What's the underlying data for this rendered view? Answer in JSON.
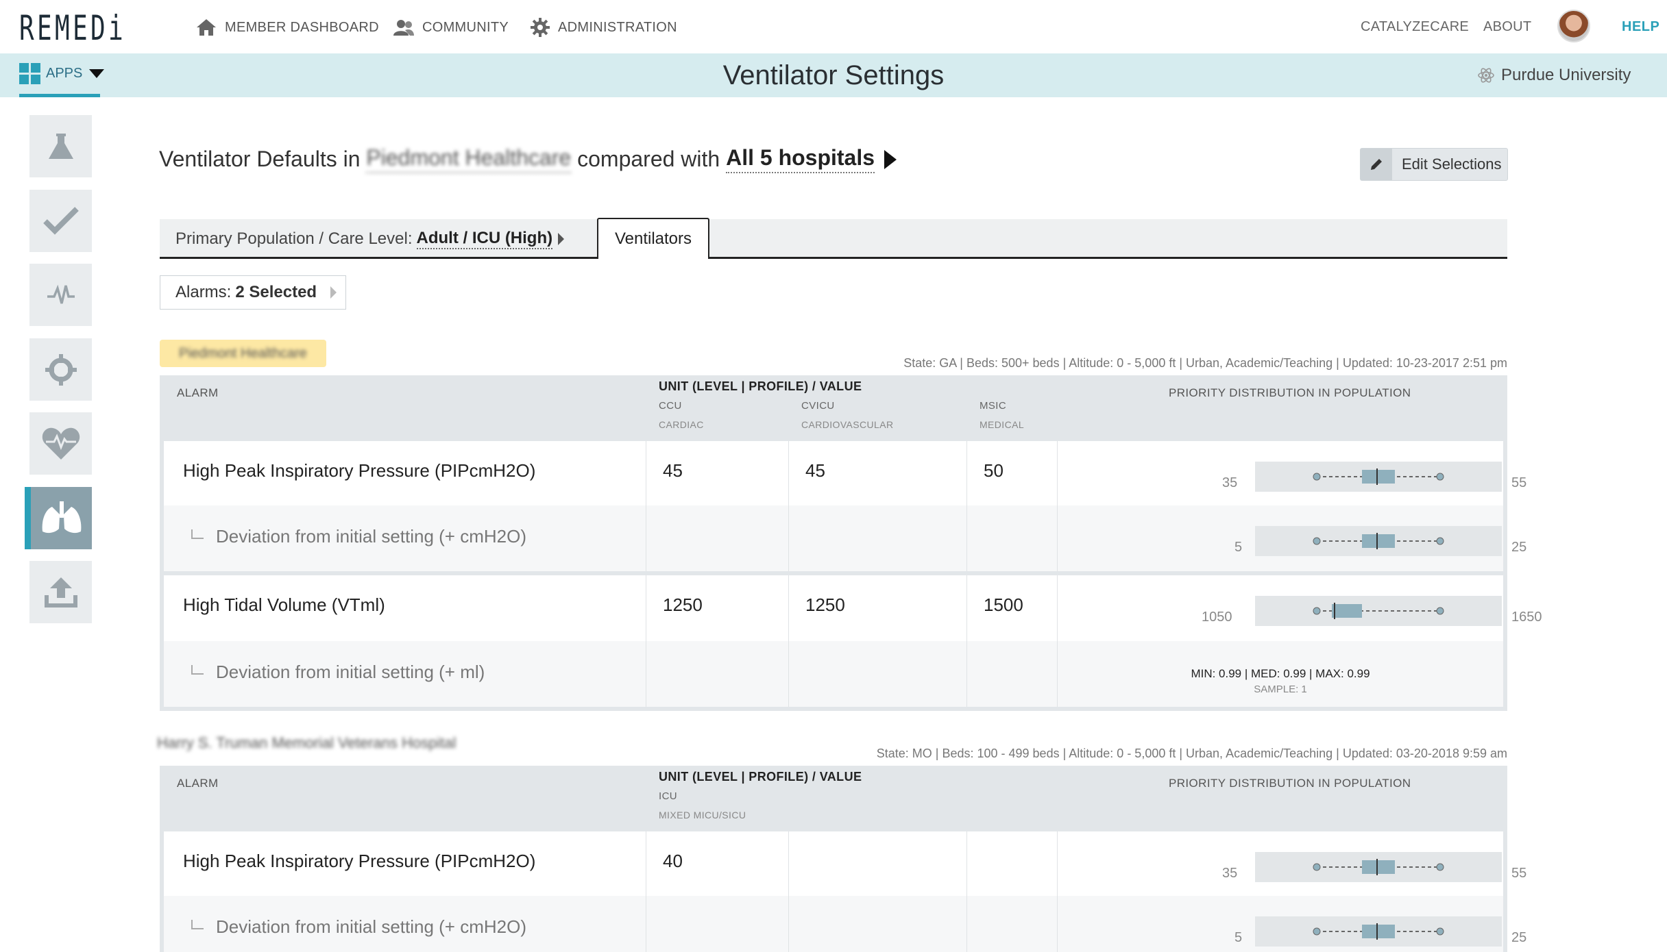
{
  "app": {
    "logo": "REMEDi",
    "nav": [
      "MEMBER DASHBOARD",
      "COMMUNITY",
      "ADMINISTRATION"
    ],
    "right_links": [
      "CATALYZECARE",
      "ABOUT"
    ],
    "help": "HELP"
  },
  "band": {
    "apps_label": "APPS",
    "title": "Ventilator Settings",
    "org": "Purdue University"
  },
  "sidebar": [
    "flask-icon",
    "check-icon",
    "pulse-icon",
    "crosshair-icon",
    "heart-icon",
    "lungs-icon",
    "upload-icon"
  ],
  "heading": {
    "prefix": "Ventilator Defaults in",
    "hospital": "Piedmont Healthcare",
    "middle": "compared with",
    "comparison": "All 5 hospitals"
  },
  "edit_button": "Edit Selections",
  "tabs": {
    "population_label": "Primary Population / Care Level:",
    "population_value": "Adult / ICU (High)",
    "ventilators": "Ventilators"
  },
  "alarms": {
    "label": "Alarms:",
    "value": "2 Selected"
  },
  "headers": {
    "alarm": "ALARM",
    "unit": "UNIT (LEVEL | PROFILE) / VALUE",
    "dist": "PRIORITY DISTRIBUTION IN POPULATION"
  },
  "hospital1": {
    "name": "Piedmont Healthcare",
    "meta": "State: GA | Beds: 500+ beds | Altitude: 0 - 5,000 ft | Urban, Academic/Teaching | Updated: 10-23-2017 2:51 pm",
    "units": [
      {
        "name": "CCU",
        "sub": "CARDIAC"
      },
      {
        "name": "CVICU",
        "sub": "CARDIOVASCULAR"
      },
      {
        "name": "MSIC",
        "sub": "MEDICAL"
      }
    ],
    "rows": [
      {
        "name": "High Peak Inspiratory Pressure (PIPcmH2O)",
        "values": [
          "45",
          "45",
          "50"
        ],
        "lo": "35",
        "hi": "55",
        "deviation": {
          "name": "Deviation from initial setting (+ cmH2O)",
          "lo": "5",
          "hi": "25"
        }
      },
      {
        "name": "High Tidal Volume (VTml)",
        "values": [
          "1250",
          "1250",
          "1500"
        ],
        "lo": "1050",
        "hi": "1650",
        "deviation": {
          "name": "Deviation from initial setting (+ ml)",
          "stats": "MIN: 0.99 | MED: 0.99 | MAX: 0.99",
          "sample": "SAMPLE: 1"
        }
      }
    ]
  },
  "hospital2": {
    "name": "Harry S. Truman Memorial Veterans Hospital",
    "meta": "State: MO | Beds: 100 - 499 beds | Altitude: 0 - 5,000 ft | Urban, Academic/Teaching | Updated: 03-20-2018 9:59 am",
    "units": [
      {
        "name": "ICU",
        "sub": "MIXED MICU/SICU"
      }
    ],
    "rows": [
      {
        "name": "High Peak Inspiratory Pressure (PIPcmH2O)",
        "values": [
          "40"
        ],
        "lo": "35",
        "hi": "55",
        "deviation": {
          "name": "Deviation from initial setting (+ cmH2O)",
          "lo": "5",
          "hi": "25"
        }
      }
    ]
  },
  "colors": {
    "accent": "#2aa0b8",
    "band": "#d6ecef",
    "hospital_tag": "#fde8a4",
    "box": "#8fb0bd"
  }
}
